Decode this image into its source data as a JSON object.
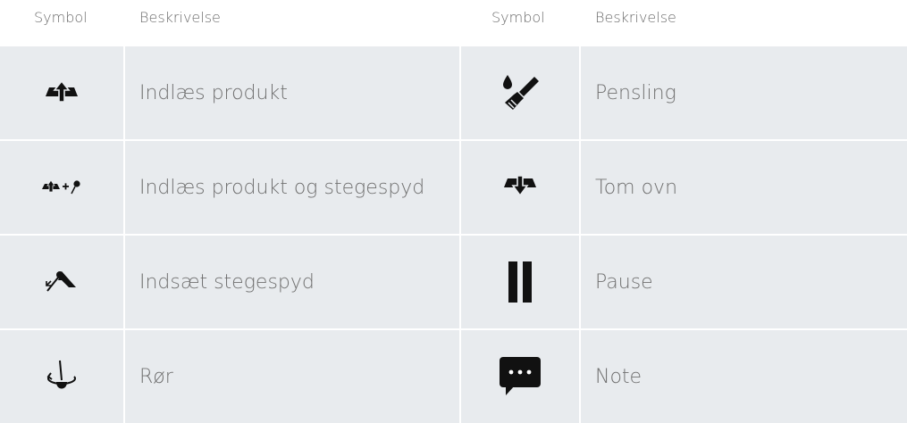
{
  "headers": {
    "left_symbol": "Symbol",
    "left_description": "Beskrivelse",
    "right_symbol": "Symbol",
    "right_description": "Beskrivelse"
  },
  "rows": [
    {
      "left_icon": "load-product-icon",
      "left_text": "Indlæs produkt",
      "right_icon": "brush-icon",
      "right_text": "Pensling"
    },
    {
      "left_icon": "load-product-and-probe-icon",
      "left_text": "Indlæs produkt og stegespyd",
      "right_icon": "empty-oven-icon",
      "right_text": "Tom ovn"
    },
    {
      "left_icon": "insert-probe-icon",
      "left_text": "Indsæt stegespyd",
      "right_icon": "pause-icon",
      "right_text": "Pause"
    },
    {
      "left_icon": "stir-icon",
      "left_text": "Rør",
      "right_icon": "note-icon",
      "right_text": "Note"
    }
  ],
  "colors": {
    "row_bg": "#e8ebee",
    "text": "#707070",
    "header_text": "#6a6a6a",
    "icon": "#111111"
  }
}
